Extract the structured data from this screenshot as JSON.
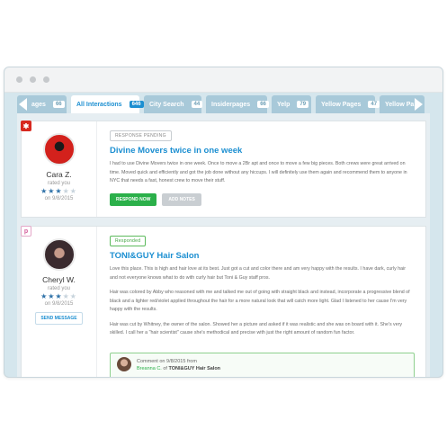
{
  "tabs": [
    {
      "label": "ages",
      "count": "66"
    },
    {
      "label": "All Interactions",
      "count": "646"
    },
    {
      "label": "City Search",
      "count": "44"
    },
    {
      "label": "Insiderpages",
      "count": "66"
    },
    {
      "label": "Yelp",
      "count": "79"
    },
    {
      "label": "Yellow Pages",
      "count": "47"
    },
    {
      "label": "Yellow Pa",
      "count": ""
    }
  ],
  "reviews": [
    {
      "source_icon": "yelp-icon",
      "source_mark": "✱",
      "name": "Cara Z.",
      "rated_label": "rated you",
      "stars": "★★★",
      "stars_off": "★★",
      "date": "on 9/8/2015",
      "status": "RESPONSE PENDING",
      "title": "Divine Movers twice in one week",
      "body": "I had to use Divine Movers twice in one week. Once to move a 2Br apt and once to move a few big pieces. Both crews were great arrived on time. Moved quick and efficiently and got the job done without any hiccups. I will definitely use them again and recommend them to anyone in NYC that needs a fast, honest crew to move their stuff.",
      "respond_label": "RESPOND NOW",
      "notes_label": "ADD NOTES"
    },
    {
      "source_icon": "insiderpages-icon",
      "source_mark": "p",
      "name": "Cheryl W.",
      "rated_label": "rated you",
      "stars": "★★★",
      "stars_off": "★★",
      "date": "on 9/8/2015",
      "send_label": "SEND MESSAGE",
      "status": "Responded",
      "title": "TONI&GUY Hair Salon",
      "body_paragraphs": [
        "Love this place. This is high and hair love at its best.  Just got a cut and color there and am very happy with the results.  I have dark, curly hair and not everyone knows what to do with curly hair but Toni & Guy staff pros.",
        "Hair was colored by Abby who reasoned with me and talked me out of going with straight black and instead, incorporate a progressive blend of black and a lighter red/violet applied throughout the hair for a more natural look that will catch more light.  Glad I listened to her cause I'm very happy with the results.",
        "Hair was cut by Whitney, the owner of the salon.  Showed her a picture and asked if it was realistic and she was on board with it.  She's very skilled. I call her a \"hair scientist\" cause she's methodical and precise with just the right amount of random fun factor."
      ],
      "comment": {
        "line1": "Comment on 9/8/2015 from",
        "author": "Breanna C.",
        "of": "of",
        "business": "TONI&GUY Hair Salon"
      }
    }
  ]
}
